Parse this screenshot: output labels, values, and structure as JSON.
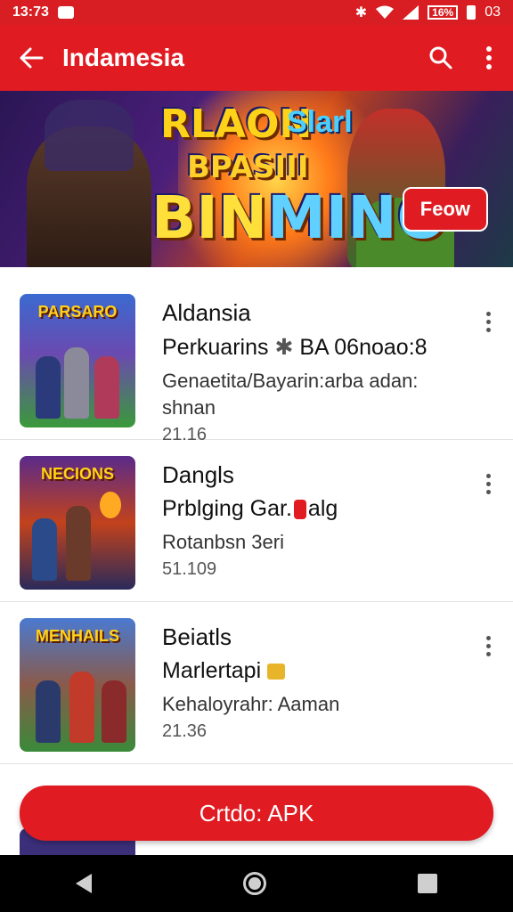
{
  "status_bar": {
    "time": "13:73",
    "battery": "16%",
    "extra": "03"
  },
  "app_bar": {
    "title": "Indamesia"
  },
  "banner": {
    "line1": "RLAON",
    "line1b": "Slarl",
    "line2": "BPASIII",
    "line3a": "BIN",
    "line3b": "MINO",
    "badge": "Feow"
  },
  "apps": [
    {
      "thumb_title": "PARSARO",
      "name": "Aldansia",
      "developer": "Perkuarins",
      "dev_suffix": "BA 06noao:8",
      "description": "Genaetita/Bayarin:arba adan: shnan",
      "meta": "21.16"
    },
    {
      "thumb_title": "NECIONS",
      "name": "Dangls",
      "developer": "Prblging Gar.",
      "dev_suffix": "alg",
      "description": "Rotanbsn 3eri",
      "meta": "51.109"
    },
    {
      "thumb_title": "MENHAILS",
      "name": "Beiatls",
      "developer": "Marlertapi",
      "dev_suffix": "",
      "description": "Kehaloyrahr: Aaman",
      "meta": "21.36"
    }
  ],
  "cta": {
    "label": "Crtdo: APK"
  },
  "colors": {
    "primary": "#e01b22",
    "statusbar": "#d81e22"
  }
}
